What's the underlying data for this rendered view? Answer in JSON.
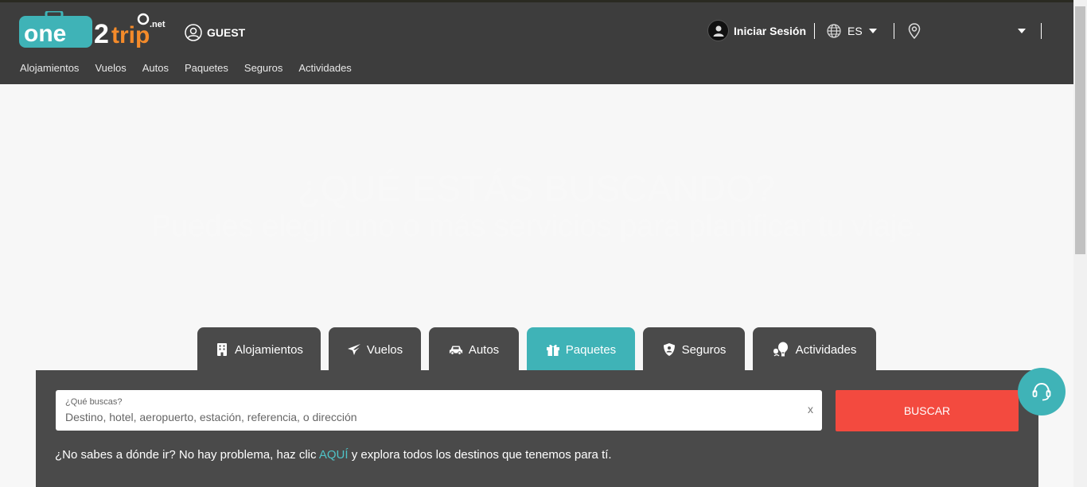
{
  "header": {
    "logo_text": "one2trip",
    "logo_suffix": ".net",
    "guest_label": "GUEST",
    "login_label": "Iniciar Sesión",
    "language": "ES",
    "location_value": ""
  },
  "nav": {
    "items": [
      "Alojamientos",
      "Vuelos",
      "Autos",
      "Paquetes",
      "Seguros",
      "Actividades"
    ]
  },
  "hero": {
    "title": "¿QUÉ ESTÁS BUSCANDO?",
    "subtitle": "Puedes elegir uno o más servicios para planificar tu viaje."
  },
  "tabs": {
    "items": [
      {
        "label": "Alojamientos",
        "icon": "building-icon"
      },
      {
        "label": "Vuelos",
        "icon": "plane-icon"
      },
      {
        "label": "Autos",
        "icon": "car-icon"
      },
      {
        "label": "Paquetes",
        "icon": "gift-icon",
        "active": true
      },
      {
        "label": "Seguros",
        "icon": "shield-icon"
      },
      {
        "label": "Actividades",
        "icon": "balloon-icon"
      }
    ]
  },
  "search": {
    "label": "¿Qué buscas?",
    "placeholder": "Destino, hotel, aeropuerto, estación, referencia, o dirección",
    "clear": "x",
    "button": "BUSCAR"
  },
  "hint": {
    "before": "¿No sabes a dónde ir? No hay problema, haz clic ",
    "link": "AQUÍ",
    "after": " y explora todos los destinos que tenemos para tí."
  },
  "colors": {
    "header_bg": "#3d3d3d",
    "accent_teal": "#3fb3b7",
    "buscar_red": "#f34a3f",
    "panel_bg": "#4a4a4a"
  }
}
